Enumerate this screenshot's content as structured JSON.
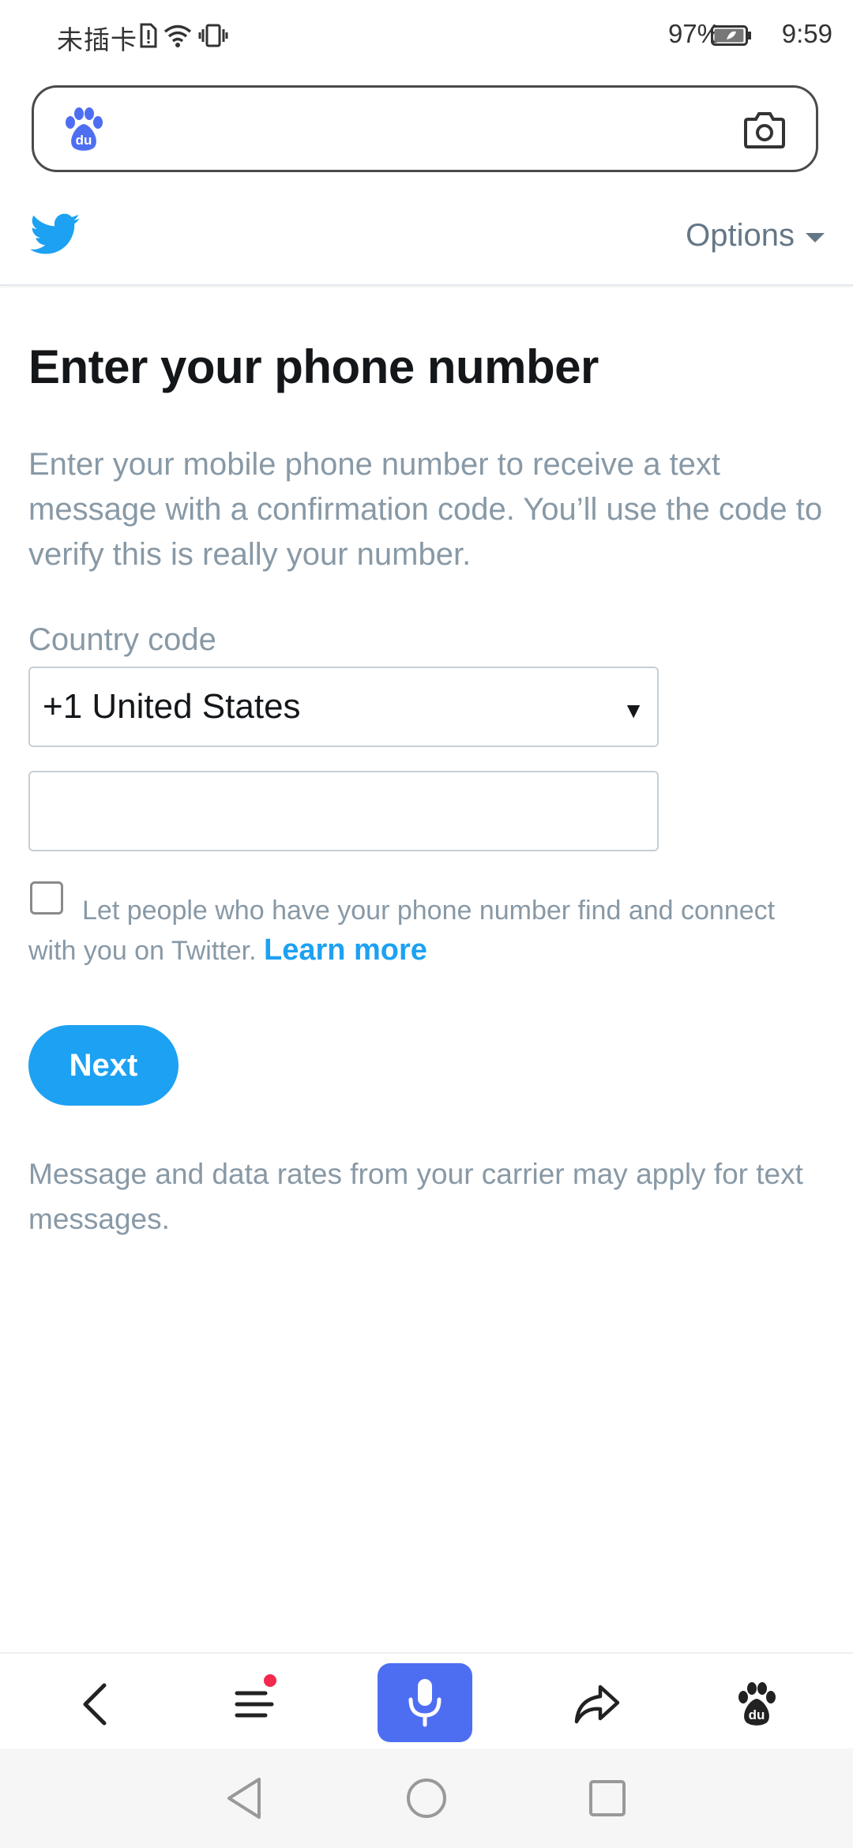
{
  "status_bar": {
    "carrier": "未插卡",
    "battery_percent": "97%",
    "battery_level": 0.97,
    "time": "9:59"
  },
  "search_bar": {
    "left_icon": "baidu-paw-icon",
    "right_icon": "camera-icon"
  },
  "header": {
    "logo": "twitter-bird-icon",
    "options_label": "Options"
  },
  "main": {
    "title": "Enter your phone number",
    "description": "Enter your mobile phone number to receive a text message with a confirmation code. You’ll use the code to verify this is really your number.",
    "country_code_label": "Country code",
    "country_code_value": "+1 United States",
    "phone_input_value": "",
    "discoverability_checked": false,
    "discoverability_text": "Let people who have your phone number find and connect with you on Twitter.",
    "learn_more_label": "Learn more",
    "next_label": "Next",
    "footnote": "Message and data rates from your carrier may apply for text messages."
  },
  "toolbar": {
    "items": [
      "back-icon",
      "menu-icon",
      "microphone-icon",
      "share-icon",
      "baidu-paw-icon"
    ]
  },
  "navbar": {
    "items": [
      "nav-back-icon",
      "nav-home-icon",
      "nav-recents-icon"
    ]
  },
  "colors": {
    "twitter_blue": "#1da1f2",
    "text_primary": "#14171a",
    "text_secondary": "#8899a6",
    "baidu_blue": "#4e6ef2",
    "notification_red": "#f5284d"
  }
}
